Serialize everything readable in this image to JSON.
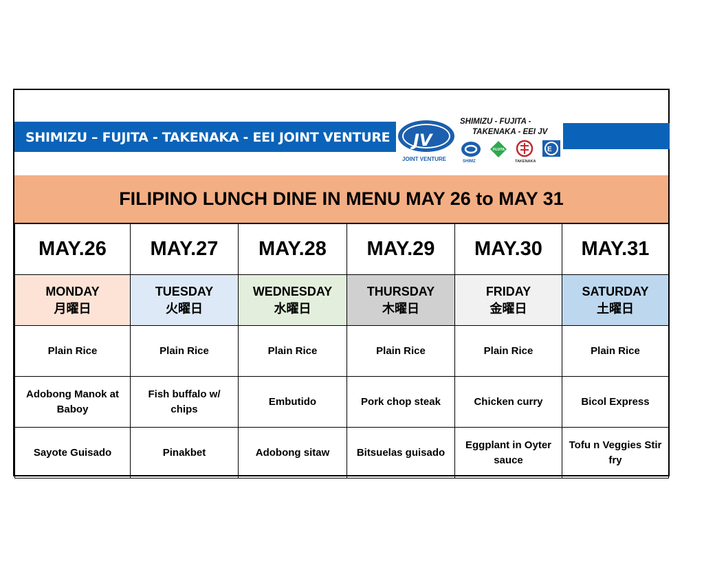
{
  "header": {
    "company_banner": "SHIMIZU – FUJITA - TAKENAKA - EEI  JOINT VENTURE",
    "logo": {
      "jv_mark": "JV",
      "jv_caption": "JOINT VENTURE",
      "brand_line_1": "SHIMIZU - FUJITA -",
      "brand_line_2": "TAKENAKA - EEI  JV",
      "sub_logos": [
        "SHIMZ",
        "FUJITA",
        "TAKENAKA",
        "EEI"
      ],
      "colors": {
        "blue": "#0a63b8",
        "fujita_green": "#2fa84f",
        "takenaka_red": "#c0282d"
      }
    }
  },
  "title": "FILIPINO LUNCH DINE IN MENU MAY 26 to MAY 31",
  "colors": {
    "title_bg": "#f4ae84",
    "banner": "#0a63b8"
  },
  "columns": [
    {
      "date": "MAY.26",
      "day": "MONDAY",
      "day_jp": "月曜日",
      "bg": "#fde3d6",
      "dishes": [
        "Plain Rice",
        "Adobong Manok at Baboy",
        "Sayote Guisado"
      ]
    },
    {
      "date": "MAY.27",
      "day": "TUESDAY",
      "day_jp": "火曜日",
      "bg": "#dde9f6",
      "dishes": [
        "Plain Rice",
        "Fish buffalo w/ chips",
        "Pinakbet"
      ]
    },
    {
      "date": "MAY.28",
      "day": "WEDNESDAY",
      "day_jp": "水曜日",
      "bg": "#e3efdc",
      "dishes": [
        "Plain Rice",
        "Embutido",
        "Adobong sitaw"
      ]
    },
    {
      "date": "MAY.29",
      "day": "THURSDAY",
      "day_jp": "木曜日",
      "bg": "#d0d0d0",
      "dishes": [
        "Plain Rice",
        "Pork chop steak",
        "Bitsuelas guisado"
      ]
    },
    {
      "date": "MAY.30",
      "day": "FRIDAY",
      "day_jp": "金曜日",
      "bg": "#f1f1f1",
      "dishes": [
        "Plain Rice",
        "Chicken curry",
        "Eggplant in Oyter sauce"
      ]
    },
    {
      "date": "MAY.31",
      "day": "SATURDAY",
      "day_jp": "土曜日",
      "bg": "#bdd7ee",
      "dishes": [
        "Plain Rice",
        "Bicol Express",
        "Tofu n Veggies Stir fry"
      ]
    }
  ]
}
